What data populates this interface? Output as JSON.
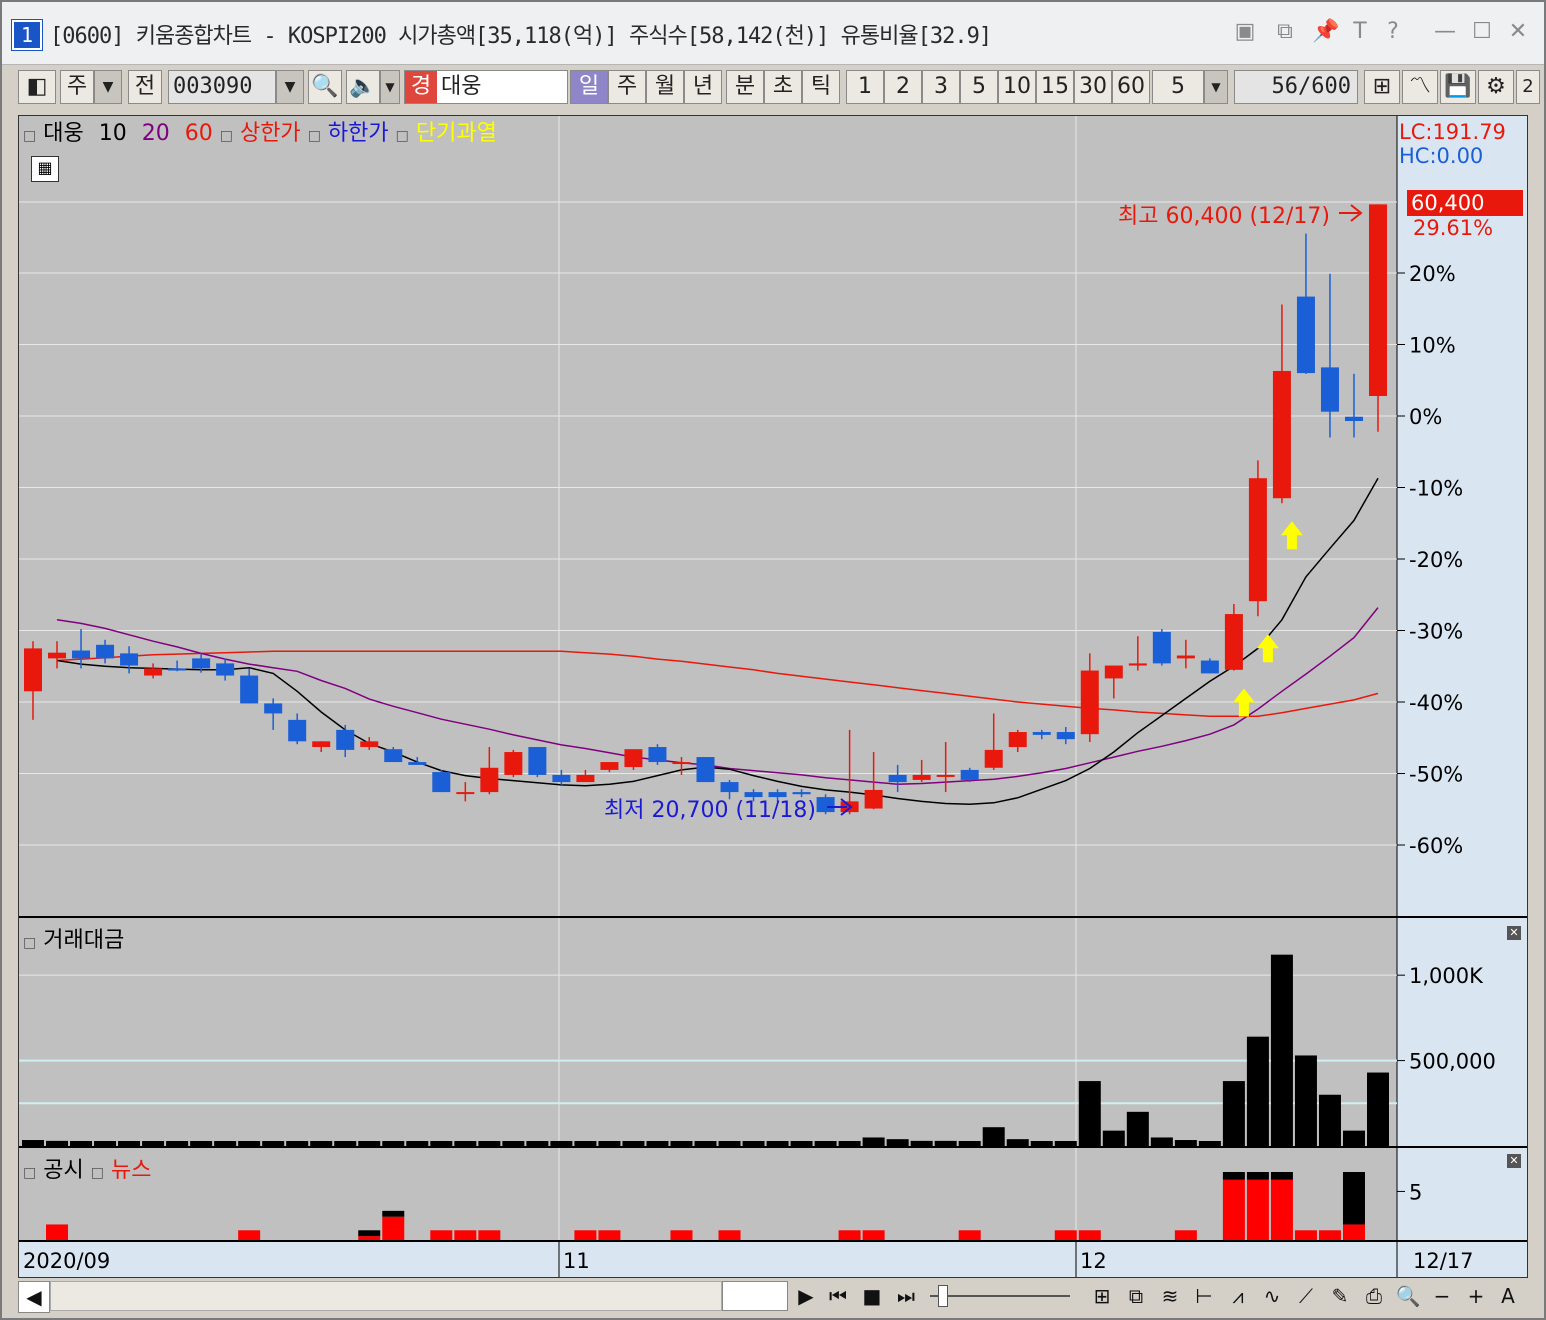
{
  "window": {
    "number": "1",
    "title": "[0600] 키움종합차트 - KOSPI200 시가총액[35,118(억)] 주식수[58,142(천)] 유통비율[32.9]"
  },
  "toolbar": {
    "market": "주",
    "prev": "전",
    "code": "003090",
    "type_badge": "경",
    "name": "대웅",
    "periods": [
      "일",
      "주",
      "월",
      "년",
      "분",
      "초",
      "틱"
    ],
    "selected_period": "일",
    "intervals": [
      "1",
      "2",
      "3",
      "5",
      "10",
      "15",
      "30",
      "60"
    ],
    "count_select": "5",
    "count": "56",
    "total": "/600",
    "extra": "2"
  },
  "legend": {
    "name": "대웅",
    "ma10": "10",
    "ma20": "20",
    "ma60": "60",
    "upper": "상한가",
    "lower": "하한가",
    "overheat": "단기과열"
  },
  "right_axis": {
    "lc": "LC:191.79",
    "hc": "HC:0.00",
    "price_label": "60,400",
    "pct_label": "29.61%"
  },
  "annotations": {
    "high": "최고 60,400 (12/17)",
    "low": "최저 20,700 (11/18)"
  },
  "volume_pane": {
    "title": "거래대금",
    "ticks": [
      "1,000K",
      "500,000"
    ]
  },
  "news_pane": {
    "title1": "공시",
    "title2": "뉴스",
    "tick": "5"
  },
  "x_axis": {
    "labels": [
      "2020/09",
      "11",
      "12"
    ],
    "last": "12/17"
  },
  "colors": {
    "up": "#e8190c",
    "down": "#1a5fd6",
    "ma10": "#000000",
    "ma20": "#800080",
    "ma60": "#e8190c",
    "right_bg": "#d9e6f2"
  },
  "chart_data": {
    "type": "candlestick",
    "y_axis_ticks": [
      "20%",
      "10%",
      "0%",
      "-10%",
      "-20%",
      "-30%",
      "-40%",
      "-50%",
      "-60%"
    ],
    "pct_levels": [
      20,
      10,
      0,
      -10,
      -20,
      -30,
      -40,
      -50,
      -60
    ],
    "pct_range": [
      -70,
      30
    ],
    "last_pct": 29.61,
    "candles": [
      {
        "o": -38.5,
        "h": -31.5,
        "l": -42.5,
        "c": -32.5
      },
      {
        "o": -33.9,
        "h": -31.5,
        "l": -35.3,
        "c": -33.1
      },
      {
        "o": -32.8,
        "h": -29.8,
        "l": -35.3,
        "c": -33.9
      },
      {
        "o": -32.0,
        "h": -31.3,
        "l": -34.6,
        "c": -33.9
      },
      {
        "o": -33.2,
        "h": -32.2,
        "l": -36.0,
        "c": -34.9
      },
      {
        "o": -36.3,
        "h": -34.6,
        "l": -36.7,
        "c": -35.3
      },
      {
        "o": -35.3,
        "h": -34.2,
        "l": -35.7,
        "c": -35.6
      },
      {
        "o": -33.9,
        "h": -33.2,
        "l": -35.9,
        "c": -35.3
      },
      {
        "o": -34.6,
        "h": -33.9,
        "l": -37.0,
        "c": -36.3
      },
      {
        "o": -36.3,
        "h": -35.3,
        "l": -40.2,
        "c": -40.2
      },
      {
        "o": -40.2,
        "h": -39.5,
        "l": -43.9,
        "c": -41.6
      },
      {
        "o": -42.5,
        "h": -41.6,
        "l": -45.9,
        "c": -45.5
      },
      {
        "o": -46.3,
        "h": -45.5,
        "l": -47.0,
        "c": -45.5
      },
      {
        "o": -43.9,
        "h": -43.2,
        "l": -47.7,
        "c": -46.7
      },
      {
        "o": -46.3,
        "h": -44.9,
        "l": -46.7,
        "c": -45.5
      },
      {
        "o": -46.6,
        "h": -46.3,
        "l": -48.4,
        "c": -48.4
      },
      {
        "o": -48.4,
        "h": -47.7,
        "l": -48.8,
        "c": -48.8
      },
      {
        "o": -49.8,
        "h": -49.5,
        "l": -52.6,
        "c": -52.6
      },
      {
        "o": -52.6,
        "h": -51.2,
        "l": -53.9,
        "c": -52.6
      },
      {
        "o": -52.6,
        "h": -46.3,
        "l": -52.9,
        "c": -49.2
      },
      {
        "o": -50.2,
        "h": -46.7,
        "l": -50.5,
        "c": -47.0
      },
      {
        "o": -46.3,
        "h": -46.3,
        "l": -50.5,
        "c": -50.2
      },
      {
        "o": -50.2,
        "h": -49.5,
        "l": -51.6,
        "c": -51.2
      },
      {
        "o": -51.2,
        "h": -49.5,
        "l": -51.2,
        "c": -50.2
      },
      {
        "o": -49.5,
        "h": -48.4,
        "l": -49.8,
        "c": -48.4
      },
      {
        "o": -49.1,
        "h": -47.7,
        "l": -49.5,
        "c": -46.6
      },
      {
        "o": -46.3,
        "h": -45.9,
        "l": -48.8,
        "c": -48.4
      },
      {
        "o": -48.4,
        "h": -47.7,
        "l": -50.2,
        "c": -48.4
      },
      {
        "o": -47.7,
        "h": -47.7,
        "l": -51.2,
        "c": -51.2
      },
      {
        "o": -51.2,
        "h": -50.9,
        "l": -53.6,
        "c": -52.6
      },
      {
        "o": -52.6,
        "h": -52.2,
        "l": -53.9,
        "c": -53.3
      },
      {
        "o": -52.6,
        "h": -52.2,
        "l": -54.0,
        "c": -53.3
      },
      {
        "o": -52.6,
        "h": -52.2,
        "l": -53.3,
        "c": -52.9
      },
      {
        "o": -53.3,
        "h": -52.9,
        "l": -55.7,
        "c": -55.4
      },
      {
        "o": -55.4,
        "h": -43.9,
        "l": -55.7,
        "c": -53.9
      },
      {
        "o": -54.9,
        "h": -47.0,
        "l": -55.0,
        "c": -52.3
      },
      {
        "o": -50.2,
        "h": -48.8,
        "l": -52.6,
        "c": -51.2
      },
      {
        "o": -50.9,
        "h": -48.1,
        "l": -51.2,
        "c": -50.2
      },
      {
        "o": -50.2,
        "h": -45.6,
        "l": -52.6,
        "c": -50.2
      },
      {
        "o": -49.5,
        "h": -49.2,
        "l": -51.2,
        "c": -50.9
      },
      {
        "o": -49.2,
        "h": -41.6,
        "l": -49.5,
        "c": -46.7
      },
      {
        "o": -46.3,
        "h": -43.9,
        "l": -47.0,
        "c": -44.2
      },
      {
        "o": -44.2,
        "h": -43.9,
        "l": -45.2,
        "c": -44.6
      },
      {
        "o": -44.2,
        "h": -43.5,
        "l": -45.9,
        "c": -45.2
      },
      {
        "o": -44.5,
        "h": -33.2,
        "l": -45.6,
        "c": -35.6
      },
      {
        "o": -36.7,
        "h": -34.9,
        "l": -39.5,
        "c": -34.9
      },
      {
        "o": -34.9,
        "h": -30.8,
        "l": -35.6,
        "c": -34.6
      },
      {
        "o": -30.2,
        "h": -29.8,
        "l": -34.9,
        "c": -34.6
      },
      {
        "o": -33.9,
        "h": -31.3,
        "l": -35.3,
        "c": -33.5
      },
      {
        "o": -34.2,
        "h": -33.9,
        "l": -36.0,
        "c": -36.0
      },
      {
        "o": -35.5,
        "h": -26.3,
        "l": -35.6,
        "c": -27.7
      },
      {
        "o": -25.9,
        "h": -6.2,
        "l": -28.0,
        "c": -8.7
      },
      {
        "o": -11.5,
        "h": 15.6,
        "l": -12.2,
        "c": 6.3
      },
      {
        "o": 16.7,
        "h": 25.5,
        "l": 5.9,
        "c": 6.0
      },
      {
        "o": 6.8,
        "h": 19.9,
        "l": -3.0,
        "c": 0.6
      },
      {
        "o": -0.1,
        "h": 5.9,
        "l": -3.0,
        "c": -0.7
      },
      {
        "o": 2.8,
        "h": 29.6,
        "l": -2.2,
        "c": 29.6
      }
    ],
    "ma10": [
      -34.2,
      -34.7,
      -35.0,
      -35.2,
      -35.3,
      -35.4,
      -35.5,
      -35.5,
      -35.2,
      -36.0,
      -38.5,
      -41.4,
      -43.9,
      -45.8,
      -47.0,
      -48.4,
      -49.6,
      -50.3,
      -50.7,
      -51.0,
      -51.3,
      -51.6,
      -51.7,
      -51.5,
      -51.1,
      -50.3,
      -49.5,
      -49.1,
      -49.4,
      -50.3,
      -51.1,
      -51.8,
      -52.3,
      -52.6,
      -53.0,
      -53.5,
      -53.9,
      -54.2,
      -54.3,
      -54.1,
      -53.4,
      -52.2,
      -51.0,
      -49.3,
      -47.0,
      -44.3,
      -41.9,
      -39.5,
      -37.1,
      -35.0,
      -32.5,
      -28.5,
      -22.5,
      -18.5,
      -14.6,
      -8.7
    ],
    "ma20": [
      -28.5,
      -29.0,
      -29.7,
      -30.6,
      -31.5,
      -32.3,
      -33.2,
      -34.0,
      -34.7,
      -35.2,
      -35.7,
      -37.0,
      -38.1,
      -39.6,
      -40.6,
      -41.5,
      -42.4,
      -43.1,
      -43.8,
      -44.6,
      -45.3,
      -46.0,
      -46.5,
      -47.1,
      -47.7,
      -48.1,
      -48.5,
      -48.8,
      -49.3,
      -49.6,
      -49.9,
      -50.2,
      -50.6,
      -50.9,
      -51.2,
      -51.5,
      -51.4,
      -51.2,
      -51.0,
      -50.8,
      -50.4,
      -49.9,
      -49.3,
      -48.5,
      -47.7,
      -46.9,
      -46.2,
      -45.4,
      -44.5,
      -43.2,
      -41.0,
      -38.5,
      -36.1,
      -33.6,
      -31.0,
      -26.8
    ],
    "ma60": [
      -34.2,
      -34.0,
      -33.8,
      -33.6,
      -33.4,
      -33.3,
      -33.2,
      -33.1,
      -33.0,
      -32.9,
      -32.9,
      -32.9,
      -32.9,
      -32.9,
      -32.9,
      -32.9,
      -32.9,
      -32.9,
      -32.9,
      -32.9,
      -32.9,
      -32.9,
      -33.1,
      -33.3,
      -33.6,
      -34.0,
      -34.3,
      -34.7,
      -35.1,
      -35.5,
      -36.0,
      -36.4,
      -36.8,
      -37.2,
      -37.6,
      -38.0,
      -38.4,
      -38.8,
      -39.2,
      -39.6,
      -40.0,
      -40.3,
      -40.6,
      -40.9,
      -41.1,
      -41.4,
      -41.6,
      -41.8,
      -42.0,
      -42.0,
      -42.0,
      -41.5,
      -40.9,
      -40.3,
      -39.7,
      -38.8
    ],
    "up_arrows": [
      50,
      51,
      52
    ],
    "volume": [
      8,
      6,
      6,
      5,
      5,
      5,
      5,
      5,
      5,
      5,
      5,
      5,
      5,
      5,
      5,
      5,
      5,
      5,
      5,
      5,
      5,
      5,
      5,
      5,
      5,
      5,
      5,
      5,
      5,
      5,
      5,
      5,
      5,
      5,
      5,
      5,
      5,
      5,
      5,
      5,
      5,
      5,
      5,
      5,
      5,
      5,
      5,
      5,
      5,
      5,
      5,
      5,
      5,
      5,
      5,
      5
    ],
    "volume_real": [
      35,
      30,
      25,
      20,
      18,
      18,
      18,
      18,
      18,
      18,
      18,
      18,
      18,
      15,
      15,
      15,
      15,
      15,
      15,
      15,
      15,
      15,
      15,
      15,
      15,
      15,
      15,
      18,
      18,
      18,
      15,
      15,
      18,
      15,
      15,
      50,
      40,
      30,
      30,
      20,
      110,
      40,
      20,
      20,
      380,
      90,
      200,
      50,
      35,
      25,
      380,
      640,
      1120,
      530,
      300,
      90,
      430
    ],
    "disclosure": [
      0,
      1,
      0,
      0,
      0,
      0,
      0,
      0,
      1,
      0,
      0,
      0,
      0,
      0,
      2,
      2,
      1,
      1,
      1,
      0,
      0,
      0,
      0,
      1,
      1,
      0,
      0,
      1,
      0,
      1,
      0,
      0,
      0,
      0,
      1,
      1,
      0,
      0,
      0,
      1,
      0,
      0,
      1,
      1,
      0,
      0,
      0,
      1,
      0,
      6.5,
      6.5,
      6.5,
      1,
      1,
      7
    ],
    "news": [
      0,
      0,
      0,
      0,
      0,
      0,
      0,
      0,
      0,
      0,
      0,
      0,
      0,
      0,
      0.5,
      0,
      0,
      0,
      0,
      0,
      0,
      0,
      0,
      0,
      0,
      0,
      0,
      0,
      0,
      0,
      0,
      0,
      0,
      0,
      0,
      0,
      0,
      0,
      0,
      0,
      0,
      0,
      0,
      0,
      0,
      0,
      0,
      0,
      0,
      0.7,
      0.7,
      0.7,
      0,
      0,
      5.5
    ]
  }
}
